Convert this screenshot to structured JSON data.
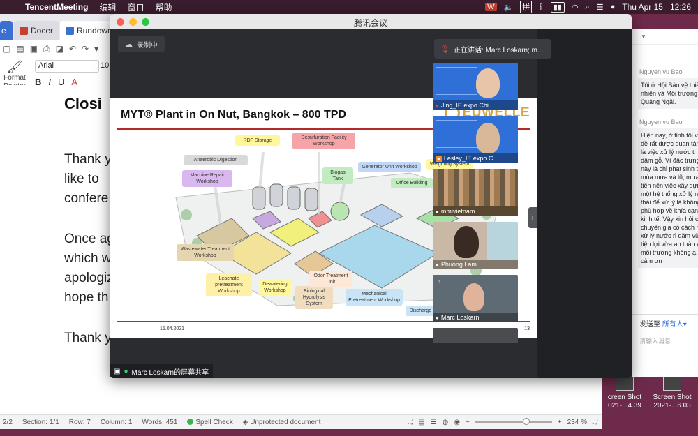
{
  "menubar": {
    "app_name": "TencentMeeting",
    "menus": [
      "编辑",
      "窗口",
      "帮助"
    ],
    "date": "Thu Apr 15",
    "time": "12:26"
  },
  "wps": {
    "tabs": [
      "e",
      "Docer",
      "Rundown(1)"
    ],
    "format_painter": "Format Painter",
    "font_name": "Arial",
    "font_size": "10",
    "doc_title": "Closi",
    "doc_lines": [
      "Thank y",
      "like  to",
      "confere",
      "Once ag",
      "which w",
      "apologiz",
      "hope th",
      "Thank y"
    ],
    "status": {
      "page": "2/2",
      "section": "Section: 1/1",
      "row": "Row: 7",
      "column": "Column: 1",
      "words": "Words: 451",
      "spell_check": "Spell Check",
      "protection": "Unprotected document",
      "zoom": "234 %",
      "zoom_fraction": 0.62
    }
  },
  "desktop": {
    "files": [
      {
        "line1": "creen Shot",
        "line2": "021-...4.39"
      },
      {
        "line1": "Screen Shot",
        "line2": "2021-...6.03"
      }
    ]
  },
  "meeting": {
    "window_title": "腾讯会议",
    "recording": "录制中",
    "share_label": "Marc Loskarn的屏幕共享",
    "speaking": "正在讲话: Marc Loskarn; m...",
    "participants": [
      {
        "name": "Jing_IE expo Chi...",
        "muted": true
      },
      {
        "name": "Lesley_IE expo C...",
        "muted": false
      },
      {
        "name": "mmivietnam",
        "muted": false
      },
      {
        "name": "Phuong Lam",
        "muted": false
      },
      {
        "name": "Marc Loskarn",
        "muted": false
      }
    ]
  },
  "slide": {
    "title": "MYT® Plant in On Nut, Bangkok – 800 TPD",
    "logo": "EUWELLE",
    "date": "15.04.2021",
    "page_number": "13",
    "labels": [
      "RDF Storage",
      "Desulfuration Facility Workshop",
      "Anaerobic Digestion",
      "Machine Repair Workshop",
      "Biogas Tank",
      "Generator Unit Workshop",
      "Weighting System",
      "Office Building",
      "Wastewater Treatment Workshop",
      "Leachate pretreatment Workshop",
      "Dewatering Workshop",
      "Biological Hydrolysis System",
      "Odor Treatment Unit",
      "Mechanical Pretreatment Workshop",
      "Discharge Workshop"
    ]
  },
  "chat": {
    "messages": [
      {
        "sender": "Nguyen vu Bao",
        "text": "Tôi ở Hội Bảo vệ thiên nhiên và Môi trường Quảng Ngãi."
      },
      {
        "sender": "Nguyen vu Bao",
        "text": "Hiện nay, ở tỉnh tôi vấn đề rất được quan tâm đó là việc xử lý nước thải dăm gỗ. Vì đặc trưng loại này là chỉ phát sinh trong mùa mưa và lũ, mưa đầu tiên nên việc xây dựng một hệ thống xử lý nước thải để xử lý là không phù hợp về khía cạnh kinh tế. Vậy xin hỏi các chuyên gia có cách nào xử lý nước rỉ dăm vừa tiện lợi vừa an toàn với môi trường không ạ. Xin cảm ơn"
      }
    ],
    "send_to_label": "发送至",
    "send_to_value": "所有人",
    "input_placeholder": "请输入消息..."
  }
}
